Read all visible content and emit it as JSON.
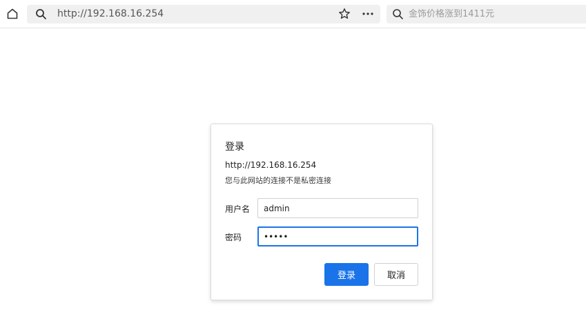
{
  "browser": {
    "address_bar": {
      "url": "http://192.168.16.254"
    },
    "search_bar": {
      "placeholder": "金饰价格涨到1411元"
    },
    "icons": {
      "home": "home-icon",
      "address_search": "search-icon",
      "bookmark": "star-icon",
      "menu": "more-icon",
      "search": "search-icon"
    }
  },
  "dialog": {
    "title": "登录",
    "url": "http://192.168.16.254",
    "warning": "您与此网站的连接不是私密连接",
    "username_label": "用户名",
    "username_value": "admin",
    "password_label": "密码",
    "password_value": "•••••",
    "login_button": "登录",
    "cancel_button": "取消"
  },
  "colors": {
    "accent": "#1a73e8",
    "toolbar_field": "#f0f0f0"
  }
}
